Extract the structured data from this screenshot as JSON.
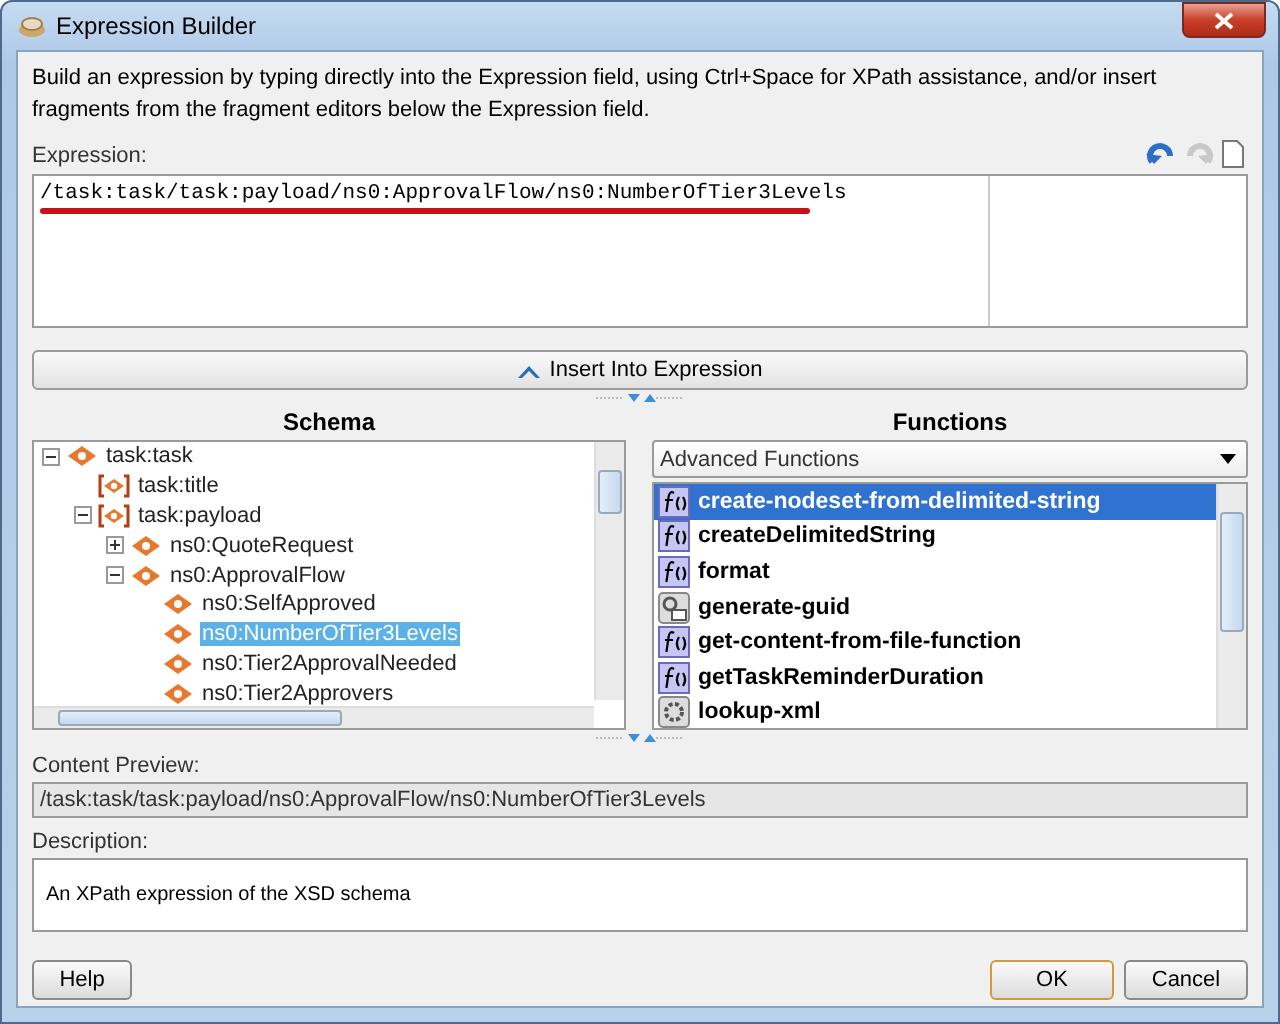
{
  "window": {
    "title": "Expression Builder"
  },
  "instructions": "Build an expression by typing directly into the Expression field, using Ctrl+Space for XPath assistance, and/or insert fragments from the fragment editors below the Expression field.",
  "expression": {
    "label": "Expression:",
    "value": "/task:task/task:payload/ns0:ApprovalFlow/ns0:NumberOfTier3Levels"
  },
  "insert_button": "Insert Into Expression",
  "schema": {
    "title": "Schema",
    "tree": [
      {
        "label": "task:task",
        "kind": "element",
        "expanded": true,
        "selected": false,
        "children": [
          {
            "label": "task:title",
            "kind": "bracketed",
            "selected": false
          },
          {
            "label": "task:payload",
            "kind": "bracketed",
            "expanded": true,
            "selected": false,
            "children": [
              {
                "label": "ns0:QuoteRequest",
                "kind": "element",
                "expanded": false,
                "selected": false
              },
              {
                "label": "ns0:ApprovalFlow",
                "kind": "element",
                "expanded": true,
                "selected": false,
                "children": [
                  {
                    "label": "ns0:SelfApproved",
                    "kind": "element",
                    "selected": false
                  },
                  {
                    "label": "ns0:NumberOfTier3Levels",
                    "kind": "element",
                    "selected": true
                  },
                  {
                    "label": "ns0:Tier2ApprovalNeeded",
                    "kind": "element",
                    "selected": false
                  },
                  {
                    "label": "ns0:Tier2Approvers",
                    "kind": "element",
                    "selected": false
                  }
                ]
              }
            ]
          }
        ]
      }
    ]
  },
  "functions": {
    "title": "Functions",
    "category": "Advanced Functions",
    "items": [
      {
        "label": "create-nodeset-from-delimited-string",
        "kind": "function",
        "selected": true
      },
      {
        "label": "createDelimitedString",
        "kind": "function",
        "selected": false
      },
      {
        "label": "format",
        "kind": "function",
        "selected": false
      },
      {
        "label": "generate-guid",
        "kind": "guid",
        "selected": false
      },
      {
        "label": "get-content-from-file-function",
        "kind": "function",
        "selected": false
      },
      {
        "label": "getTaskReminderDuration",
        "kind": "function",
        "selected": false
      },
      {
        "label": "lookup-xml",
        "kind": "xml",
        "selected": false
      }
    ]
  },
  "content_preview": {
    "label": "Content Preview:",
    "value": "/task:task/task:payload/ns0:ApprovalFlow/ns0:NumberOfTier3Levels"
  },
  "description": {
    "label": "Description:",
    "value": "An XPath expression of the XSD schema"
  },
  "buttons": [
    {
      "label": "Help",
      "kind": "help"
    },
    {
      "label": "OK",
      "kind": "ok"
    },
    {
      "label": "Cancel",
      "kind": "cancel"
    }
  ]
}
